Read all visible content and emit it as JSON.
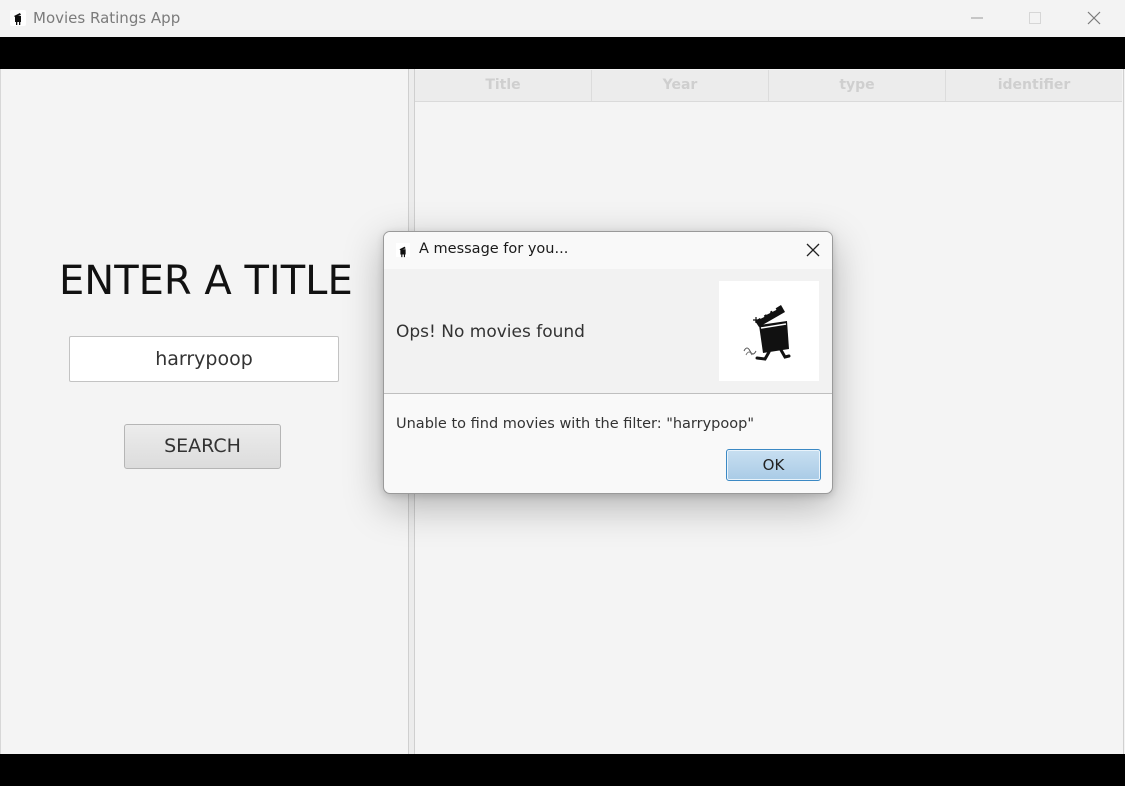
{
  "window": {
    "title": "Movies Ratings App"
  },
  "left": {
    "heading": "ENTER A TITLE",
    "search_value": "harrypoop",
    "search_button": "SEARCH"
  },
  "table": {
    "columns": [
      "Title",
      "Year",
      "type",
      "identifier"
    ]
  },
  "dialog": {
    "title": "A message for you...",
    "header_text": "Ops! No movies found",
    "content_text": "Unable to find movies with the filter: \"harrypoop\"",
    "ok_label": "OK"
  },
  "icons": {
    "app": "clapperboard-icon",
    "minimize": "minimize-icon",
    "maximize": "maximize-icon",
    "close": "close-icon",
    "dialog_graphic": "running-clapperboard-icon"
  },
  "colors": {
    "ok_button": "#a9cbe6",
    "ok_border": "#3b89c4",
    "bar": "#000000"
  }
}
